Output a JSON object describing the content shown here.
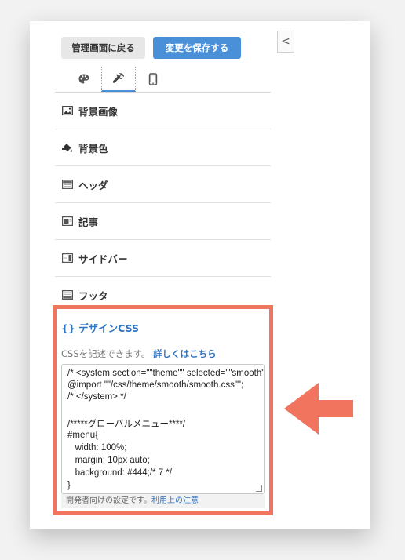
{
  "toolbar": {
    "back_label": "管理画面に戻る",
    "save_label": "変更を保存する",
    "collapse_glyph": "<"
  },
  "tabs": [
    {
      "icon": "palette-icon",
      "active": false
    },
    {
      "icon": "wrench-icon",
      "active": true
    },
    {
      "icon": "mobile-icon",
      "active": false
    }
  ],
  "menu": {
    "items": [
      {
        "label": "背景画像",
        "icon": "image-icon"
      },
      {
        "label": "背景色",
        "icon": "paint-bucket-icon"
      },
      {
        "label": "ヘッダ",
        "icon": "header-layout-icon"
      },
      {
        "label": "記事",
        "icon": "article-layout-icon"
      },
      {
        "label": "サイドバー",
        "icon": "sidebar-layout-icon"
      },
      {
        "label": "フッタ",
        "icon": "footer-layout-icon"
      }
    ]
  },
  "css_section": {
    "icon_glyph": "{}",
    "title": "デザインCSS",
    "description": "CSSを記述できます。",
    "details_link": "詳しくはこちら",
    "code_lines": [
      "/* <system section=\"\"theme\"\" selected=\"\"smooth\"\">",
      "@import \"\"/css/theme/smooth/smooth.css\"\";",
      "/* </system> */",
      "",
      "/*****グローバルメニュー****/",
      "#menu{",
      "   width: 100%;",
      "   margin: 10px auto;",
      "   background: #444;/* 7 */",
      "}"
    ],
    "dev_note": "開発者向けの設定です。",
    "dev_link": "利用上の注意"
  },
  "colors": {
    "accent": "#4a90d9",
    "highlight_border": "#f0745e",
    "arrow": "#f0745e"
  }
}
